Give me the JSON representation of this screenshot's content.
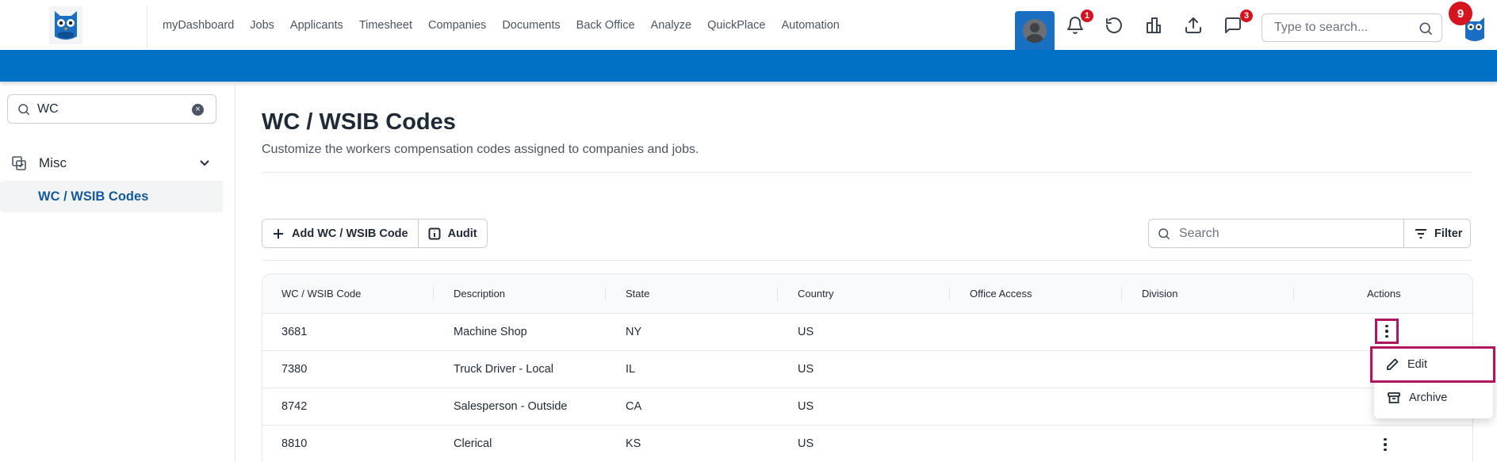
{
  "nav": {
    "items": [
      "myDashboard",
      "Jobs",
      "Applicants",
      "Timesheet",
      "Companies",
      "Documents",
      "Back Office",
      "Analyze",
      "QuickPlace",
      "Automation"
    ],
    "notifications_badge": "1",
    "messages_badge": "3",
    "search_placeholder": "Type to search...",
    "profile_badge": "9"
  },
  "sidebar": {
    "search_value": "WC",
    "section_label": "Misc",
    "active_item": "WC / WSIB Codes"
  },
  "page": {
    "title": "WC / WSIB Codes",
    "subtitle": "Customize the workers compensation codes assigned to companies and jobs.",
    "add_button": "Add WC / WSIB Code",
    "audit_button": "Audit",
    "search_placeholder": "Search",
    "filter_button": "Filter"
  },
  "table": {
    "headers": [
      "WC / WSIB Code",
      "Description",
      "State",
      "Country",
      "Office Access",
      "Division",
      "Actions"
    ],
    "rows": [
      {
        "code": "3681",
        "description": "Machine Shop",
        "state": "NY",
        "country": "US",
        "office": "",
        "division": ""
      },
      {
        "code": "7380",
        "description": "Truck Driver - Local",
        "state": "IL",
        "country": "US",
        "office": "",
        "division": ""
      },
      {
        "code": "8742",
        "description": "Salesperson - Outside",
        "state": "CA",
        "country": "US",
        "office": "",
        "division": ""
      },
      {
        "code": "8810",
        "description": "Clerical",
        "state": "KS",
        "country": "US",
        "office": "",
        "division": ""
      }
    ]
  },
  "action_menu": {
    "edit": "Edit",
    "archive": "Archive"
  },
  "colors": {
    "brand_blue": "#0071c5",
    "highlight": "#b0175e",
    "badge_red": "#d6141f"
  }
}
